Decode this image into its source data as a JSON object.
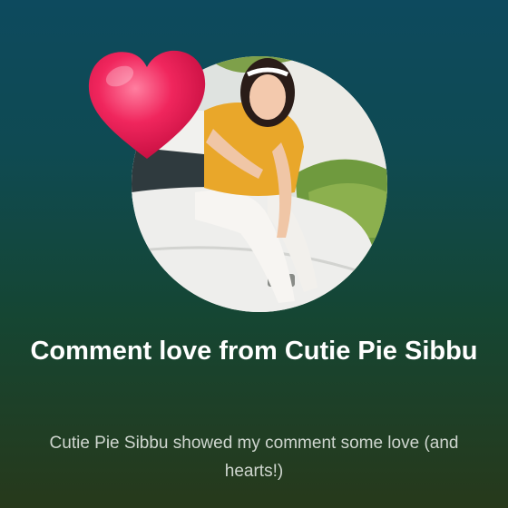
{
  "notification": {
    "title": "Comment love from Cutie Pie Sibbu",
    "subtitle": "Cutie Pie Sibbu showed my comment some love (and hearts!)"
  },
  "icons": {
    "heart": "heart-icon",
    "avatar": "profile-photo"
  },
  "colors": {
    "heart": "#e8174f",
    "title": "#ffffff",
    "subtitle": "#cfd6cf"
  }
}
